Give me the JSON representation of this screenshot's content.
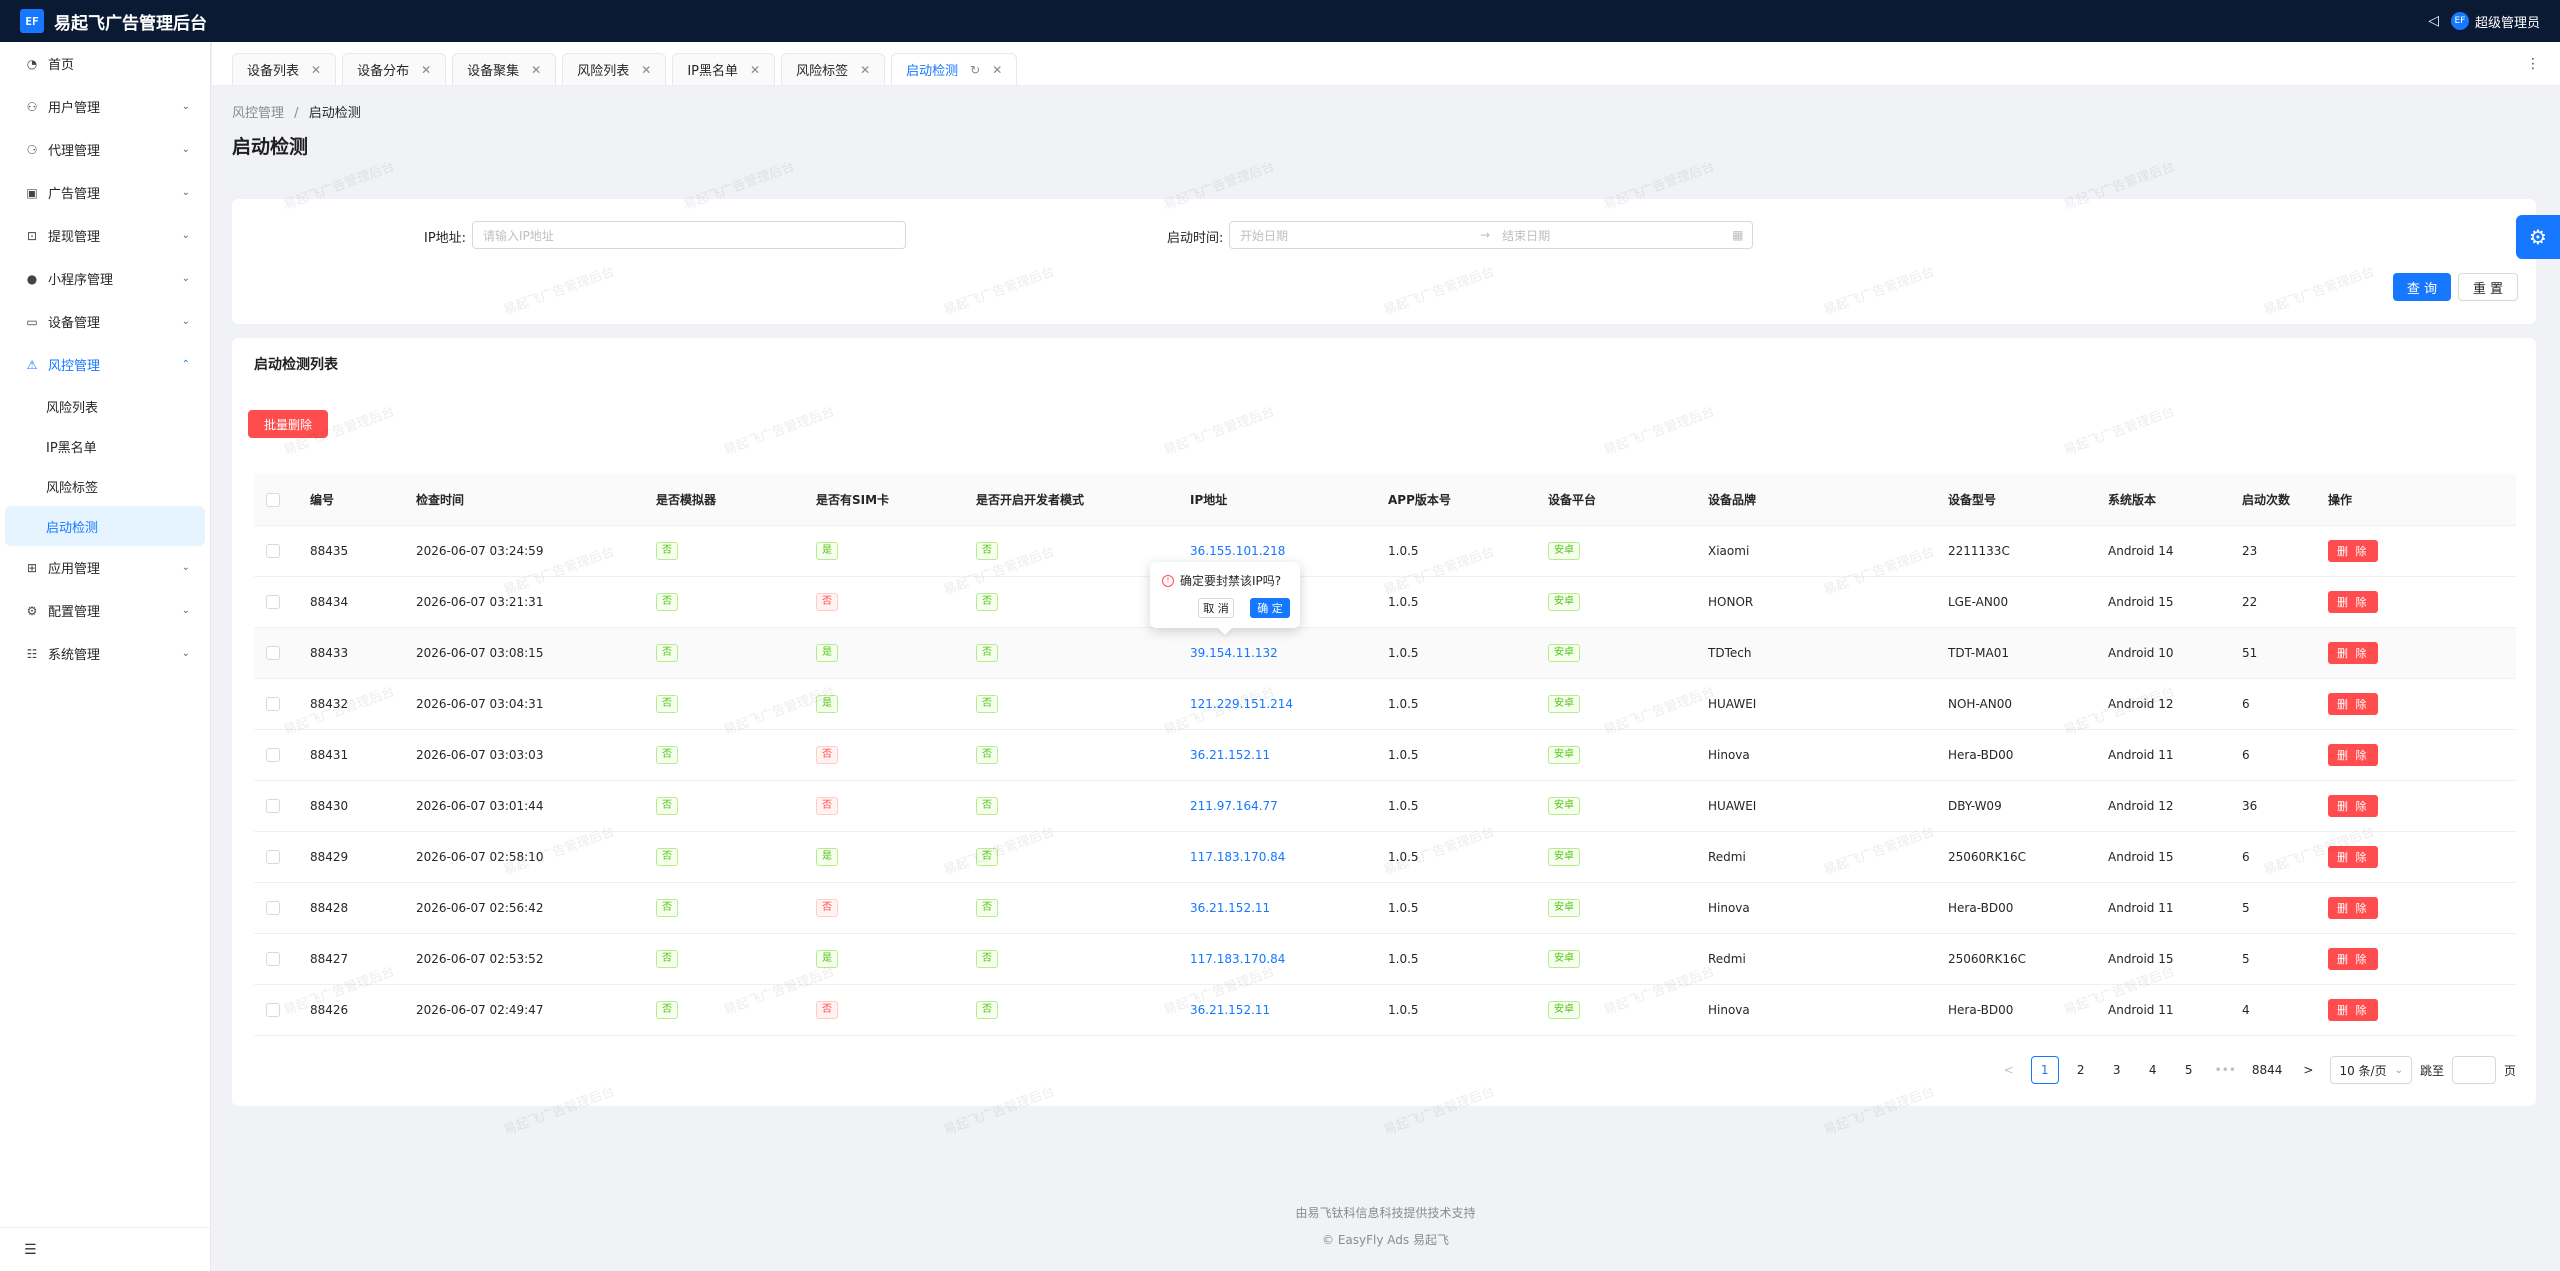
{
  "app": {
    "title": "易起飞广告管理后台",
    "logo_text": "EF",
    "user": "超级管理员",
    "avatar_text": "EF"
  },
  "sidebar": {
    "items": [
      {
        "label": "首页",
        "icon": "dashboard-icon"
      },
      {
        "label": "用户管理",
        "icon": "user-icon"
      },
      {
        "label": "代理管理",
        "icon": "agent-icon"
      },
      {
        "label": "广告管理",
        "icon": "ad-icon"
      },
      {
        "label": "提现管理",
        "icon": "withdraw-icon"
      },
      {
        "label": "小程序管理",
        "icon": "wechat-icon"
      },
      {
        "label": "设备管理",
        "icon": "monitor-icon"
      },
      {
        "label": "风控管理",
        "icon": "warning-icon"
      },
      {
        "label": "应用管理",
        "icon": "apps-icon"
      },
      {
        "label": "配置管理",
        "icon": "settings-icon"
      },
      {
        "label": "系统管理",
        "icon": "system-icon"
      }
    ],
    "sub_items": [
      "风险列表",
      "IP黑名单",
      "风险标签",
      "启动检测"
    ]
  },
  "tabs": [
    {
      "label": "设备列表"
    },
    {
      "label": "设备分布"
    },
    {
      "label": "设备聚集"
    },
    {
      "label": "风险列表"
    },
    {
      "label": "IP黑名单"
    },
    {
      "label": "风险标签"
    },
    {
      "label": "启动检测"
    }
  ],
  "breadcrumb": {
    "parent": "风控管理",
    "sep": "/",
    "current": "启动检测"
  },
  "page_title": "启动检测",
  "search": {
    "ip_label": "IP地址:",
    "ip_placeholder": "请输入IP地址",
    "time_label": "启动时间:",
    "start_placeholder": "开始日期",
    "end_placeholder": "结束日期",
    "arrow": "→",
    "query": "查 询",
    "reset": "重 置"
  },
  "list": {
    "title": "启动检测列表",
    "batch_delete": "批量删除",
    "columns": [
      "编号",
      "检查时间",
      "是否模拟器",
      "是否有SIM卡",
      "是否开启开发者模式",
      "IP地址",
      "APP版本号",
      "设备平台",
      "设备品牌",
      "设备型号",
      "系统版本",
      "启动次数",
      "操作"
    ],
    "rows": [
      {
        "id": "88435",
        "time": "2026-06-07 03:24:59",
        "emu": "否",
        "sim": "是",
        "dev": "否",
        "ip": "36.155.101.218",
        "ver": "1.0.5",
        "platform": "安卓",
        "brand": "Xiaomi",
        "model": "2211133C",
        "os": "Android 14",
        "count": "23",
        "op": "删 除"
      },
      {
        "id": "88434",
        "time": "2026-06-07 03:21:31",
        "emu": "否",
        "sim": "否",
        "dev": "否",
        "ip": "",
        "ver": "1.0.5",
        "platform": "安卓",
        "brand": "HONOR",
        "model": "LGE-AN00",
        "os": "Android 15",
        "count": "22",
        "op": "删 除"
      },
      {
        "id": "88433",
        "time": "2026-06-07 03:08:15",
        "emu": "否",
        "sim": "是",
        "dev": "否",
        "ip": "39.154.11.132",
        "ver": "1.0.5",
        "platform": "安卓",
        "brand": "TDTech",
        "model": "TDT-MA01",
        "os": "Android 10",
        "count": "51",
        "op": "删 除"
      },
      {
        "id": "88432",
        "time": "2026-06-07 03:04:31",
        "emu": "否",
        "sim": "是",
        "dev": "否",
        "ip": "121.229.151.214",
        "ver": "1.0.5",
        "platform": "安卓",
        "brand": "HUAWEI",
        "model": "NOH-AN00",
        "os": "Android 12",
        "count": "6",
        "op": "删 除"
      },
      {
        "id": "88431",
        "time": "2026-06-07 03:03:03",
        "emu": "否",
        "sim": "否",
        "dev": "否",
        "ip": "36.21.152.11",
        "ver": "1.0.5",
        "platform": "安卓",
        "brand": "Hinova",
        "model": "Hera-BD00",
        "os": "Android 11",
        "count": "6",
        "op": "删 除"
      },
      {
        "id": "88430",
        "time": "2026-06-07 03:01:44",
        "emu": "否",
        "sim": "否",
        "dev": "否",
        "ip": "211.97.164.77",
        "ver": "1.0.5",
        "platform": "安卓",
        "brand": "HUAWEI",
        "model": "DBY-W09",
        "os": "Android 12",
        "count": "36",
        "op": "删 除"
      },
      {
        "id": "88429",
        "time": "2026-06-07 02:58:10",
        "emu": "否",
        "sim": "是",
        "dev": "否",
        "ip": "117.183.170.84",
        "ver": "1.0.5",
        "platform": "安卓",
        "brand": "Redmi",
        "model": "25060RK16C",
        "os": "Android 15",
        "count": "6",
        "op": "删 除"
      },
      {
        "id": "88428",
        "time": "2026-06-07 02:56:42",
        "emu": "否",
        "sim": "否",
        "dev": "否",
        "ip": "36.21.152.11",
        "ver": "1.0.5",
        "platform": "安卓",
        "brand": "Hinova",
        "model": "Hera-BD00",
        "os": "Android 11",
        "count": "5",
        "op": "删 除"
      },
      {
        "id": "88427",
        "time": "2026-06-07 02:53:52",
        "emu": "否",
        "sim": "是",
        "dev": "否",
        "ip": "117.183.170.84",
        "ver": "1.0.5",
        "platform": "安卓",
        "brand": "Redmi",
        "model": "25060RK16C",
        "os": "Android 15",
        "count": "5",
        "op": "删 除"
      },
      {
        "id": "88426",
        "time": "2026-06-07 02:49:47",
        "emu": "否",
        "sim": "否",
        "dev": "否",
        "ip": "36.21.152.11",
        "ver": "1.0.5",
        "platform": "安卓",
        "brand": "Hinova",
        "model": "Hera-BD00",
        "os": "Android 11",
        "count": "4",
        "op": "删 除"
      }
    ]
  },
  "popconfirm": {
    "text": "确定要封禁该IP吗?",
    "cancel": "取 消",
    "ok": "确 定"
  },
  "pagination": {
    "pages": [
      "1",
      "2",
      "3",
      "4",
      "5"
    ],
    "ellipsis": "•••",
    "last": "8844",
    "size": "10 条/页",
    "jump": "跳至",
    "page_unit": "页",
    "prev": "<",
    "next": ">"
  },
  "footer": {
    "line1": "由易飞钛科信息科技提供技术支持",
    "line2": "© EasyFly Ads 易起飞"
  },
  "watermark": "易起飞广告管理后台",
  "colors": {
    "primary": "#1677ff",
    "danger": "#ff4d4f",
    "success": "#52c41a",
    "topbar": "#0b1a33"
  }
}
